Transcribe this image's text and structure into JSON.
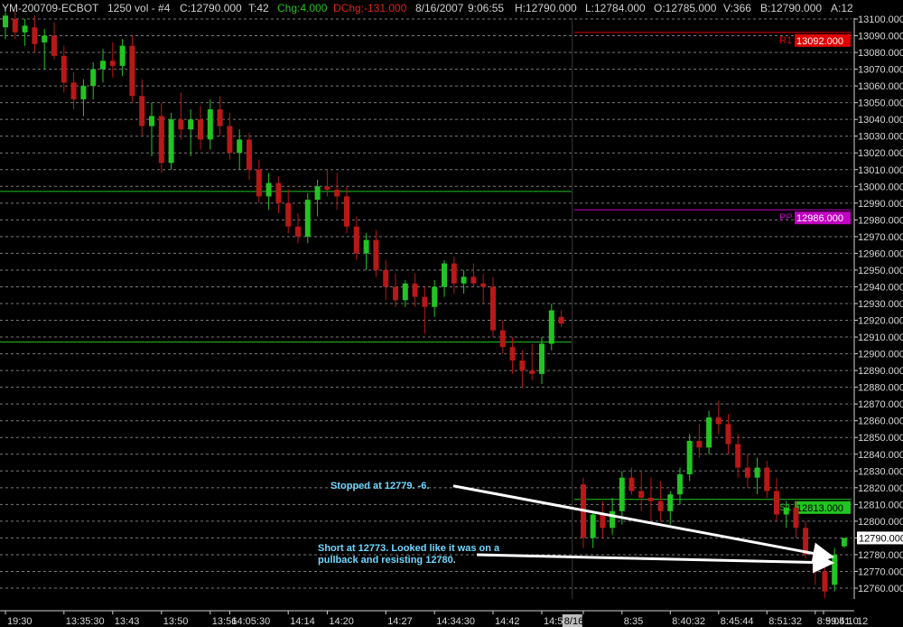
{
  "header": {
    "symbol": "YM-200709-ECBOT",
    "interval": "1250 vol - #4",
    "close": "C:12790.000",
    "ticks": "T:42",
    "change": "Chg:4.000",
    "daily_change": "DChg:-131.000",
    "date": "8/16/2007",
    "time": "9:06:55",
    "high": "H:12790.000",
    "low": "L:12784.000",
    "open": "O:12785.000",
    "volume": "V:366",
    "bid": "B:12790.000",
    "ask": "A:12"
  },
  "colors": {
    "up": "#22c422",
    "down": "#b81818",
    "grid": "#7a7a7a",
    "r1": "#e00000",
    "pp": "#c000c0",
    "s1": "#22c422",
    "annotation": "#6fd8ff",
    "arrow": "#ffffff"
  },
  "chart_data": {
    "type": "candlestick",
    "ylim": [
      12750,
      13105
    ],
    "y_ticks": [
      "13100.000",
      "13090.000",
      "13080.000",
      "13070.000",
      "13060.000",
      "13050.000",
      "13040.000",
      "13030.000",
      "13020.000",
      "13010.000",
      "13000.000",
      "12990.000",
      "12980.000",
      "12970.000",
      "12960.000",
      "12950.000",
      "12940.000",
      "12930.000",
      "12920.000",
      "12910.000",
      "12900.000",
      "12890.000",
      "12880.000",
      "12870.000",
      "12860.000",
      "12850.000",
      "12840.000",
      "12830.000",
      "12820.000",
      "12810.000",
      "12800.000",
      "12790.000",
      "12780.000",
      "12770.000",
      "12760.000"
    ],
    "x_labels": [
      "19:30",
      "13:35:30",
      "13:43",
      "13:50",
      "13:56",
      "14:05:30",
      "14:14",
      "14:20",
      "14:27",
      "14:34:30",
      "14:42",
      "14:56:30",
      "8/16",
      "8:35",
      "8:40:32",
      "8:45:44",
      "8:51:32",
      "8:59:41",
      "9:05:10"
    ],
    "last_price": "12790.000",
    "last_price_bottom_label": "12",
    "session_split_label": "8/16",
    "levels": [
      {
        "name": "R1",
        "value": 13092,
        "label": "13092.000",
        "scope": "day2"
      },
      {
        "name": "PP",
        "value": 12986,
        "label": "12986.000",
        "scope": "day2"
      },
      {
        "name": "S1",
        "value": 12813,
        "label": "12813.000",
        "scope": "day2"
      },
      {
        "name": "",
        "value": 12997,
        "label": "",
        "scope": "day1"
      },
      {
        "name": "",
        "value": 12907,
        "label": "",
        "scope": "day1"
      }
    ],
    "candles": [
      {
        "o": 13095,
        "h": 13104,
        "l": 13088,
        "c": 13102
      },
      {
        "o": 13100,
        "h": 13105,
        "l": 13088,
        "c": 13092
      },
      {
        "o": 13092,
        "h": 13100,
        "l": 13084,
        "c": 13096
      },
      {
        "o": 13095,
        "h": 13102,
        "l": 13080,
        "c": 13085
      },
      {
        "o": 13086,
        "h": 13094,
        "l": 13070,
        "c": 13090
      },
      {
        "o": 13090,
        "h": 13098,
        "l": 13076,
        "c": 13078
      },
      {
        "o": 13078,
        "h": 13084,
        "l": 13056,
        "c": 13062
      },
      {
        "o": 13062,
        "h": 13068,
        "l": 13046,
        "c": 13052
      },
      {
        "o": 13052,
        "h": 13064,
        "l": 13042,
        "c": 13060
      },
      {
        "o": 13060,
        "h": 13074,
        "l": 13052,
        "c": 13070
      },
      {
        "o": 13070,
        "h": 13082,
        "l": 13062,
        "c": 13075
      },
      {
        "o": 13075,
        "h": 13086,
        "l": 13065,
        "c": 13072
      },
      {
        "o": 13072,
        "h": 13088,
        "l": 13066,
        "c": 13084
      },
      {
        "o": 13084,
        "h": 13090,
        "l": 13050,
        "c": 13054
      },
      {
        "o": 13054,
        "h": 13064,
        "l": 13030,
        "c": 13036
      },
      {
        "o": 13036,
        "h": 13050,
        "l": 13018,
        "c": 13042
      },
      {
        "o": 13042,
        "h": 13050,
        "l": 13008,
        "c": 13014
      },
      {
        "o": 13014,
        "h": 13044,
        "l": 13010,
        "c": 13040
      },
      {
        "o": 13040,
        "h": 13056,
        "l": 13028,
        "c": 13034
      },
      {
        "o": 13034,
        "h": 13046,
        "l": 13018,
        "c": 13040
      },
      {
        "o": 13040,
        "h": 13048,
        "l": 13022,
        "c": 13028
      },
      {
        "o": 13028,
        "h": 13052,
        "l": 13022,
        "c": 13046
      },
      {
        "o": 13046,
        "h": 13054,
        "l": 13030,
        "c": 13036
      },
      {
        "o": 13036,
        "h": 13044,
        "l": 13016,
        "c": 13020
      },
      {
        "o": 13020,
        "h": 13034,
        "l": 13010,
        "c": 13028
      },
      {
        "o": 13028,
        "h": 13032,
        "l": 13004,
        "c": 13010
      },
      {
        "o": 13010,
        "h": 13016,
        "l": 12990,
        "c": 12994
      },
      {
        "o": 12994,
        "h": 13008,
        "l": 12986,
        "c": 13002
      },
      {
        "o": 13002,
        "h": 13006,
        "l": 12984,
        "c": 12990
      },
      {
        "o": 12990,
        "h": 12998,
        "l": 12972,
        "c": 12976
      },
      {
        "o": 12976,
        "h": 12984,
        "l": 12966,
        "c": 12970
      },
      {
        "o": 12970,
        "h": 12996,
        "l": 12966,
        "c": 12992
      },
      {
        "o": 12992,
        "h": 13004,
        "l": 12982,
        "c": 13000
      },
      {
        "o": 13000,
        "h": 13010,
        "l": 12994,
        "c": 12998
      },
      {
        "o": 12998,
        "h": 13008,
        "l": 12986,
        "c": 12994
      },
      {
        "o": 12994,
        "h": 13000,
        "l": 12972,
        "c": 12976
      },
      {
        "o": 12976,
        "h": 12982,
        "l": 12956,
        "c": 12960
      },
      {
        "o": 12960,
        "h": 12972,
        "l": 12950,
        "c": 12968
      },
      {
        "o": 12968,
        "h": 12974,
        "l": 12946,
        "c": 12950
      },
      {
        "o": 12950,
        "h": 12956,
        "l": 12932,
        "c": 12940
      },
      {
        "o": 12940,
        "h": 12948,
        "l": 12928,
        "c": 12932
      },
      {
        "o": 12932,
        "h": 12944,
        "l": 12928,
        "c": 12942
      },
      {
        "o": 12942,
        "h": 12948,
        "l": 12928,
        "c": 12934
      },
      {
        "o": 12934,
        "h": 12940,
        "l": 12912,
        "c": 12928
      },
      {
        "o": 12928,
        "h": 12944,
        "l": 12922,
        "c": 12940
      },
      {
        "o": 12940,
        "h": 12956,
        "l": 12934,
        "c": 12954
      },
      {
        "o": 12954,
        "h": 12958,
        "l": 12936,
        "c": 12942
      },
      {
        "o": 12942,
        "h": 12950,
        "l": 12936,
        "c": 12946
      },
      {
        "o": 12946,
        "h": 12954,
        "l": 12940,
        "c": 12942
      },
      {
        "o": 12942,
        "h": 12948,
        "l": 12930,
        "c": 12940
      },
      {
        "o": 12940,
        "h": 12946,
        "l": 12910,
        "c": 12914
      },
      {
        "o": 12914,
        "h": 12920,
        "l": 12900,
        "c": 12904
      },
      {
        "o": 12904,
        "h": 12910,
        "l": 12888,
        "c": 12896
      },
      {
        "o": 12896,
        "h": 12902,
        "l": 12880,
        "c": 12890
      },
      {
        "o": 12890,
        "h": 12906,
        "l": 12884,
        "c": 12888
      },
      {
        "o": 12888,
        "h": 12910,
        "l": 12882,
        "c": 12906
      },
      {
        "o": 12906,
        "h": 12930,
        "l": 12902,
        "c": 12926
      },
      {
        "o": 12922,
        "h": 12926,
        "l": 12916,
        "c": 12918
      },
      {
        "o": 12822,
        "h": 12826,
        "l": 12784,
        "c": 12790
      },
      {
        "o": 12790,
        "h": 12806,
        "l": 12784,
        "c": 12804
      },
      {
        "o": 12804,
        "h": 12812,
        "l": 12790,
        "c": 12796
      },
      {
        "o": 12796,
        "h": 12814,
        "l": 12792,
        "c": 12806
      },
      {
        "o": 12806,
        "h": 12830,
        "l": 12798,
        "c": 12826
      },
      {
        "o": 12826,
        "h": 12832,
        "l": 12816,
        "c": 12818
      },
      {
        "o": 12818,
        "h": 12830,
        "l": 12806,
        "c": 12814
      },
      {
        "o": 12814,
        "h": 12826,
        "l": 12800,
        "c": 12812
      },
      {
        "o": 12812,
        "h": 12824,
        "l": 12800,
        "c": 12806
      },
      {
        "o": 12806,
        "h": 12818,
        "l": 12798,
        "c": 12816
      },
      {
        "o": 12816,
        "h": 12832,
        "l": 12810,
        "c": 12828
      },
      {
        "o": 12828,
        "h": 12852,
        "l": 12824,
        "c": 12848
      },
      {
        "o": 12848,
        "h": 12858,
        "l": 12838,
        "c": 12844
      },
      {
        "o": 12844,
        "h": 12866,
        "l": 12840,
        "c": 12862
      },
      {
        "o": 12862,
        "h": 12872,
        "l": 12852,
        "c": 12858
      },
      {
        "o": 12858,
        "h": 12864,
        "l": 12840,
        "c": 12846
      },
      {
        "o": 12846,
        "h": 12852,
        "l": 12826,
        "c": 12832
      },
      {
        "o": 12832,
        "h": 12840,
        "l": 12820,
        "c": 12826
      },
      {
        "o": 12826,
        "h": 12838,
        "l": 12816,
        "c": 12832
      },
      {
        "o": 12832,
        "h": 12836,
        "l": 12814,
        "c": 12818
      },
      {
        "o": 12818,
        "h": 12826,
        "l": 12800,
        "c": 12804
      },
      {
        "o": 12804,
        "h": 12812,
        "l": 12796,
        "c": 12808
      },
      {
        "o": 12808,
        "h": 12812,
        "l": 12790,
        "c": 12796
      },
      {
        "o": 12796,
        "h": 12800,
        "l": 12778,
        "c": 12780
      },
      {
        "o": 12780,
        "h": 12786,
        "l": 12762,
        "c": 12770
      },
      {
        "o": 12770,
        "h": 12776,
        "l": 12754,
        "c": 12758
      },
      {
        "o": 12762,
        "h": 12784,
        "l": 12758,
        "c": 12780
      },
      {
        "o": 12785,
        "h": 12790,
        "l": 12784,
        "c": 12790
      }
    ],
    "annotations": [
      {
        "text": "Stopped at 12779.  -6.",
        "from_bar": 59,
        "from_price": 12820,
        "to_bar": 84,
        "to_price": 12779
      },
      {
        "text_lines": [
          "Short at 12773.  Looked like it was on a",
          "pullback and resisting 12780."
        ],
        "from_bar": 64,
        "from_price": 12782,
        "to_bar": 84,
        "to_price": 12773
      }
    ]
  }
}
